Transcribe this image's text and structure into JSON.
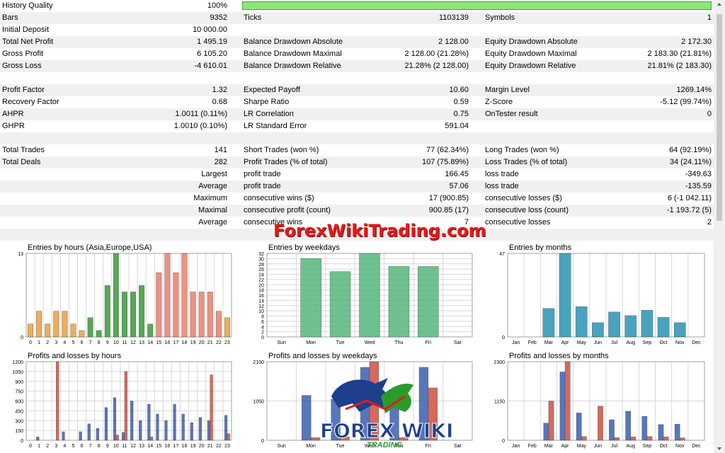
{
  "history_quality": {
    "label": "History Quality",
    "value": "100%",
    "fill": 1.0
  },
  "rows": [
    {
      "alt": true,
      "l1": "Bars",
      "v1": "9352",
      "l2": "Ticks",
      "v2": "1103139",
      "l3": "Symbols",
      "v3": "1"
    },
    {
      "alt": false,
      "l1": "Initial Deposit",
      "v1": "10 000.00",
      "l2": "",
      "v2": "",
      "l3": "",
      "v3": ""
    },
    {
      "alt": true,
      "l1": "Total Net Profit",
      "v1": "1 495.19",
      "l2": "Balance Drawdown Absolute",
      "v2": "2 128.00",
      "l3": "Equity Drawdown Absolute",
      "v3": "2 172.30"
    },
    {
      "alt": false,
      "l1": "Gross Profit",
      "v1": "6 105.20",
      "l2": "Balance Drawdown Maximal",
      "v2": "2 128.00 (21.28%)",
      "l3": "Equity Drawdown Maximal",
      "v3": "2 183.30 (21.81%)"
    },
    {
      "alt": true,
      "l1": "Gross Loss",
      "v1": "-4 610.01",
      "l2": "Balance Drawdown Relative",
      "v2": "21.28% (2 128.00)",
      "l3": "Equity Drawdown Relative",
      "v3": "21.81% (2 183.30)"
    },
    {
      "alt": false,
      "l1": "",
      "v1": "",
      "l2": "",
      "v2": "",
      "l3": "",
      "v3": ""
    },
    {
      "alt": true,
      "l1": "Profit Factor",
      "v1": "1.32",
      "l2": "Expected Payoff",
      "v2": "10.60",
      "l3": "Margin Level",
      "v3": "1269.14%"
    },
    {
      "alt": false,
      "l1": "Recovery Factor",
      "v1": "0.68",
      "l2": "Sharpe Ratio",
      "v2": "0.59",
      "l3": "Z-Score",
      "v3": "-5.12 (99.74%)"
    },
    {
      "alt": true,
      "l1": "AHPR",
      "v1": "1.0011 (0.11%)",
      "l2": "LR Correlation",
      "v2": "0.75",
      "l3": "OnTester result",
      "v3": "0"
    },
    {
      "alt": false,
      "l1": "GHPR",
      "v1": "1.0010 (0.10%)",
      "l2": "LR Standard Error",
      "v2": "591.04",
      "l3": "",
      "v3": ""
    },
    {
      "alt": true,
      "l1": "",
      "v1": "",
      "l2": "",
      "v2": "",
      "l3": "",
      "v3": ""
    },
    {
      "alt": false,
      "l1": "Total Trades",
      "v1": "141",
      "l2": "Short Trades (won %)",
      "v2": "77 (62.34%)",
      "l3": "Long Trades (won %)",
      "v3": "64 (92.19%)"
    },
    {
      "alt": true,
      "l1": "Total Deals",
      "v1": "282",
      "l2": "Profit Trades (% of total)",
      "v2": "107 (75.89%)",
      "l3": "Loss Trades (% of total)",
      "v3": "34 (24.11%)"
    },
    {
      "alt": false,
      "l1": "",
      "v1": "Largest",
      "l2": "profit trade",
      "v2": "166.45",
      "l3": "loss trade",
      "v3": "-349.63"
    },
    {
      "alt": true,
      "l1": "",
      "v1": "Average",
      "l2": "profit trade",
      "v2": "57.06",
      "l3": "loss trade",
      "v3": "-135.59"
    },
    {
      "alt": false,
      "l1": "",
      "v1": "Maximum",
      "l2": "consecutive wins ($)",
      "v2": "17 (900.85)",
      "l3": "consecutive losses ($)",
      "v3": "6 (-1 042.11)"
    },
    {
      "alt": true,
      "l1": "",
      "v1": "Maximal",
      "l2": "consecutive profit (count)",
      "v2": "900.85 (17)",
      "l3": "consecutive loss (count)",
      "v3": "-1 193.72 (5)"
    },
    {
      "alt": false,
      "l1": "",
      "v1": "Average",
      "l2": "consecutive wins",
      "v2": "7",
      "l3": "consecutive losses",
      "v3": "2"
    },
    {
      "alt": true,
      "l1": "",
      "v1": "",
      "l2": "",
      "v2": "",
      "l3": "",
      "v3": ""
    }
  ],
  "watermark": "ForexWikiTrading.com",
  "logo": {
    "text": "FOREX WIKI",
    "sub": "TRADING"
  },
  "colors": {
    "row_alt": "#f0f0f0",
    "quality_fill": "#8de67a",
    "grid": "#d8d8d8"
  },
  "chart_data": [
    {
      "type": "bar",
      "title": "Entries by hours (Asia,Europe,USA)",
      "categories": [
        "0",
        "1",
        "2",
        "3",
        "4",
        "5",
        "6",
        "7",
        "8",
        "9",
        "10",
        "11",
        "12",
        "13",
        "14",
        "15",
        "16",
        "17",
        "18",
        "19",
        "20",
        "21",
        "22",
        "23"
      ],
      "values": [
        2,
        4,
        2,
        4,
        4,
        2,
        1,
        3,
        1,
        8,
        13,
        7,
        7,
        8,
        2,
        10,
        13,
        10,
        13,
        7,
        7,
        7,
        4,
        3
      ],
      "ylim": [
        0,
        13
      ],
      "yticks": [
        0,
        13
      ],
      "bar_colors": [
        "#e8a040",
        "#e8a040",
        "#e8a040",
        "#e8a040",
        "#e8a040",
        "#e8a040",
        "#e8a040",
        "#3a9a3a",
        "#3a9a3a",
        "#3a9a3a",
        "#3a9a3a",
        "#3a9a3a",
        "#3a9a3a",
        "#3a9a3a",
        "#3a9a3a",
        "#e8806a",
        "#e8806a",
        "#e8806a",
        "#e8806a",
        "#e8806a",
        "#e8806a",
        "#e8806a",
        "#e8806a",
        "#e8a040"
      ]
    },
    {
      "type": "bar",
      "title": "Entries by weekdays",
      "categories": [
        "Sun",
        "Mon",
        "Tue",
        "Wed",
        "Thu",
        "Fri",
        "Sat"
      ],
      "values": [
        0,
        30,
        25,
        32,
        27,
        27,
        0
      ],
      "ylim": [
        0,
        32
      ],
      "yticks": [
        0,
        2,
        4,
        6,
        8,
        10,
        12,
        14,
        16,
        18,
        20,
        22,
        24,
        26,
        28,
        30,
        32
      ],
      "bar_color": "#56b77c"
    },
    {
      "type": "bar",
      "title": "Entries by months",
      "categories": [
        "Jan",
        "Feb",
        "Mar",
        "Apr",
        "May",
        "Jun",
        "Jul",
        "Aug",
        "Sep",
        "Oct",
        "Nov",
        "Dec"
      ],
      "values": [
        0,
        0,
        16,
        47,
        17,
        8,
        14,
        12,
        15,
        11,
        8,
        0
      ],
      "ylim": [
        0,
        47
      ],
      "yticks": [
        0,
        47
      ],
      "bar_color": "#2a93b3"
    },
    {
      "type": "bar",
      "title": "Profits and losses by hours",
      "categories": [
        "0",
        "1",
        "2",
        "3",
        "4",
        "5",
        "6",
        "7",
        "8",
        "9",
        "10",
        "11",
        "12",
        "13",
        "14",
        "15",
        "16",
        "17",
        "18",
        "19",
        "20",
        "21",
        "22",
        "23"
      ],
      "series": [
        {
          "values": [
            0,
            50,
            0,
            0,
            130,
            0,
            130,
            250,
            180,
            500,
            650,
            120,
            600,
            300,
            550,
            400,
            300,
            550,
            400,
            270,
            350,
            300,
            0,
            380
          ],
          "color": "#3b5fb0"
        },
        {
          "values": [
            0,
            0,
            0,
            1200,
            0,
            0,
            0,
            0,
            0,
            0,
            80,
            1050,
            0,
            0,
            50,
            0,
            0,
            0,
            0,
            0,
            0,
            1000,
            0,
            100
          ],
          "color": "#d05040"
        }
      ],
      "ylim": [
        0,
        1200
      ],
      "yticks": [
        0,
        150,
        300,
        450,
        600,
        750,
        900,
        1050,
        1200
      ]
    },
    {
      "type": "bar",
      "title": "Profits and losses by weekdays",
      "categories": [
        "Sun",
        "Mon",
        "Tue",
        "Wed",
        "Thu",
        "Fri",
        "Sat"
      ],
      "series": [
        {
          "values": [
            0,
            1200,
            1100,
            1950,
            1350,
            1950,
            0
          ],
          "color": "#3b5fb0"
        },
        {
          "values": [
            0,
            70,
            90,
            2100,
            70,
            1400,
            0
          ],
          "color": "#d05040"
        }
      ],
      "ylim": [
        0,
        2100
      ],
      "yticks": [
        0,
        1050,
        2100
      ]
    },
    {
      "type": "bar",
      "title": "Profits and losses by months",
      "categories": [
        "Jan",
        "Feb",
        "Mar",
        "Apr",
        "May",
        "Jun",
        "Jul",
        "Aug",
        "Sep",
        "Oct",
        "Nov",
        "Dec"
      ],
      "series": [
        {
          "values": [
            0,
            0,
            500,
            2000,
            800,
            0,
            600,
            850,
            700,
            460,
            470,
            0
          ],
          "color": "#3b5fb0"
        },
        {
          "values": [
            0,
            0,
            1150,
            2300,
            110,
            1000,
            80,
            100,
            110,
            100,
            70,
            0
          ],
          "color": "#d05040"
        }
      ],
      "ylim": [
        0,
        2300
      ],
      "yticks": [
        0,
        1150,
        2300
      ]
    }
  ]
}
